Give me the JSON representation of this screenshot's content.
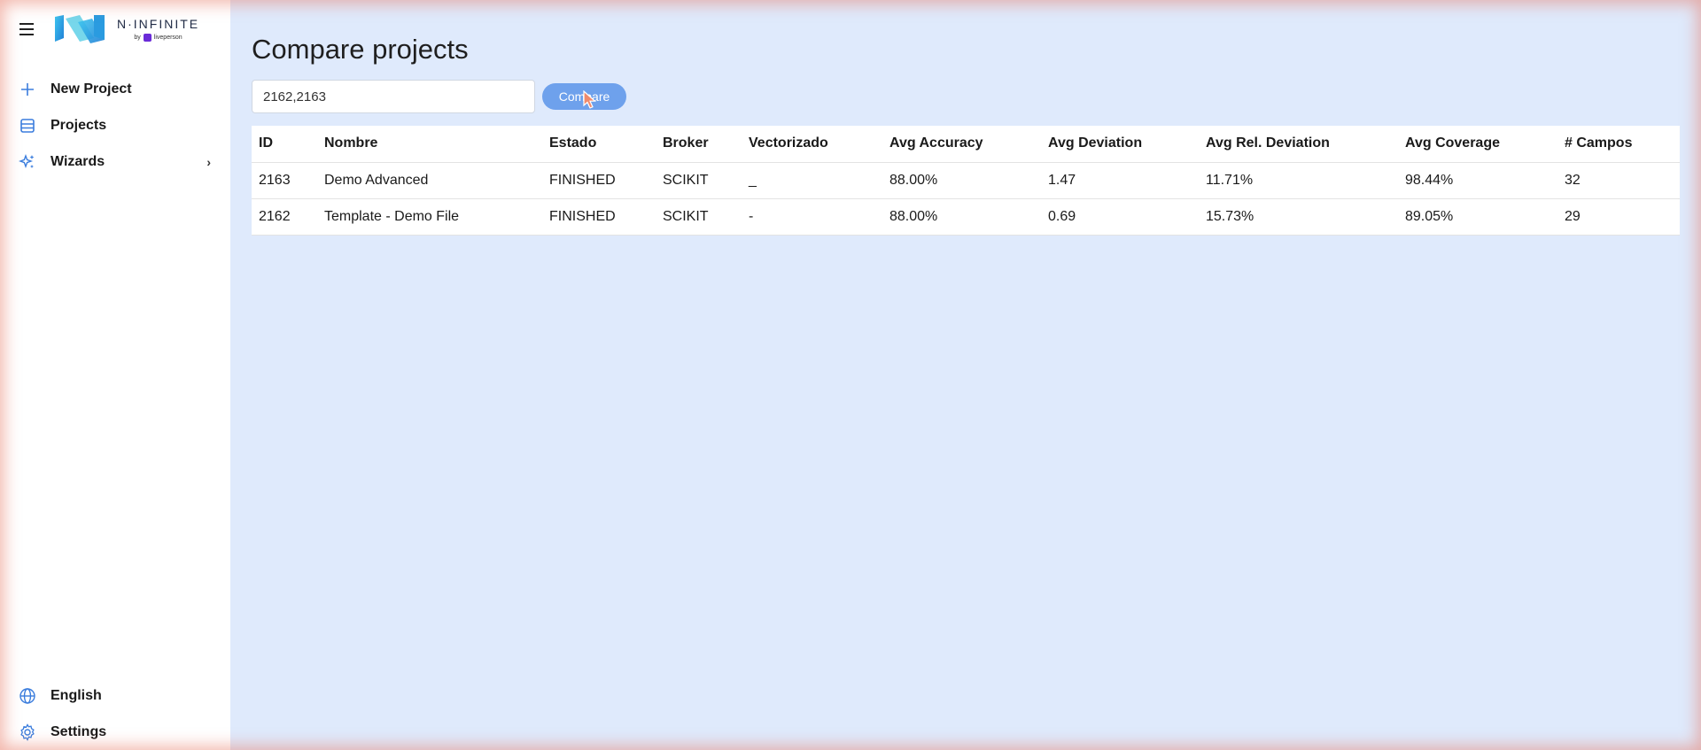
{
  "brand": {
    "name": "N·INFINITE",
    "by": "by",
    "partner": "liveperson",
    "accent": "#2fa8e8"
  },
  "sidebar": {
    "items": [
      {
        "label": "New Project",
        "icon": "plus-icon"
      },
      {
        "label": "Projects",
        "icon": "database-icon"
      },
      {
        "label": "Wizards",
        "icon": "sparkles-icon",
        "has_submenu": true
      }
    ],
    "bottom": [
      {
        "label": "English",
        "icon": "globe-icon"
      },
      {
        "label": "Settings",
        "icon": "gear-icon"
      }
    ]
  },
  "main": {
    "title": "Compare projects",
    "input_value": "2162,2163",
    "compare_label": "Compare",
    "table": {
      "headers": [
        "ID",
        "Nombre",
        "Estado",
        "Broker",
        "Vectorizado",
        "Avg Accuracy",
        "Avg Deviation",
        "Avg Rel. Deviation",
        "Avg Coverage",
        "# Campos"
      ],
      "rows": [
        [
          "2163",
          "Demo Advanced",
          "FINISHED",
          "SCIKIT",
          "_",
          "88.00%",
          "1.47",
          "11.71%",
          "98.44%",
          "32"
        ],
        [
          "2162",
          "Template - Demo File",
          "FINISHED",
          "SCIKIT",
          "-",
          "88.00%",
          "0.69",
          "15.73%",
          "89.05%",
          "29"
        ]
      ]
    }
  },
  "colors": {
    "background": "#dfeafc",
    "button": "#6ea1ec",
    "icon": "#3b7ddd"
  }
}
